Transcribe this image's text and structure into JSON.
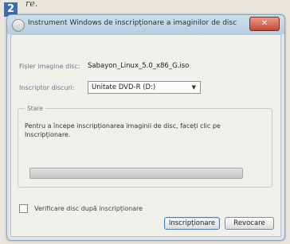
{
  "step": {
    "number": "2",
    "fragment": "re."
  },
  "window": {
    "title": "Instrument Windows de inscripționare a imaginilor de disc",
    "close_symbol": "✕",
    "source_label": "Fișier imagine disc:",
    "source_value": "Sabayon_Linux_5.0_x86_G.iso",
    "burner_label": "Inscriptor discuri:",
    "burner_selected": "Unitate DVD-R (D:)",
    "status_group_title": "Stare",
    "status_text": "Pentru a începe inscripționarea imaginii de disc, faceți clic pe Inscripționare.",
    "progress": 0,
    "verify_checkbox_label": "Verificare disc după inscripționare",
    "verify_checked": false,
    "burn_button": "Inscripționare",
    "cancel_button": "Revocare"
  },
  "icons": {
    "title": "disc-burner-icon",
    "close": "close-icon",
    "dropdown": "chevron-down-icon"
  }
}
